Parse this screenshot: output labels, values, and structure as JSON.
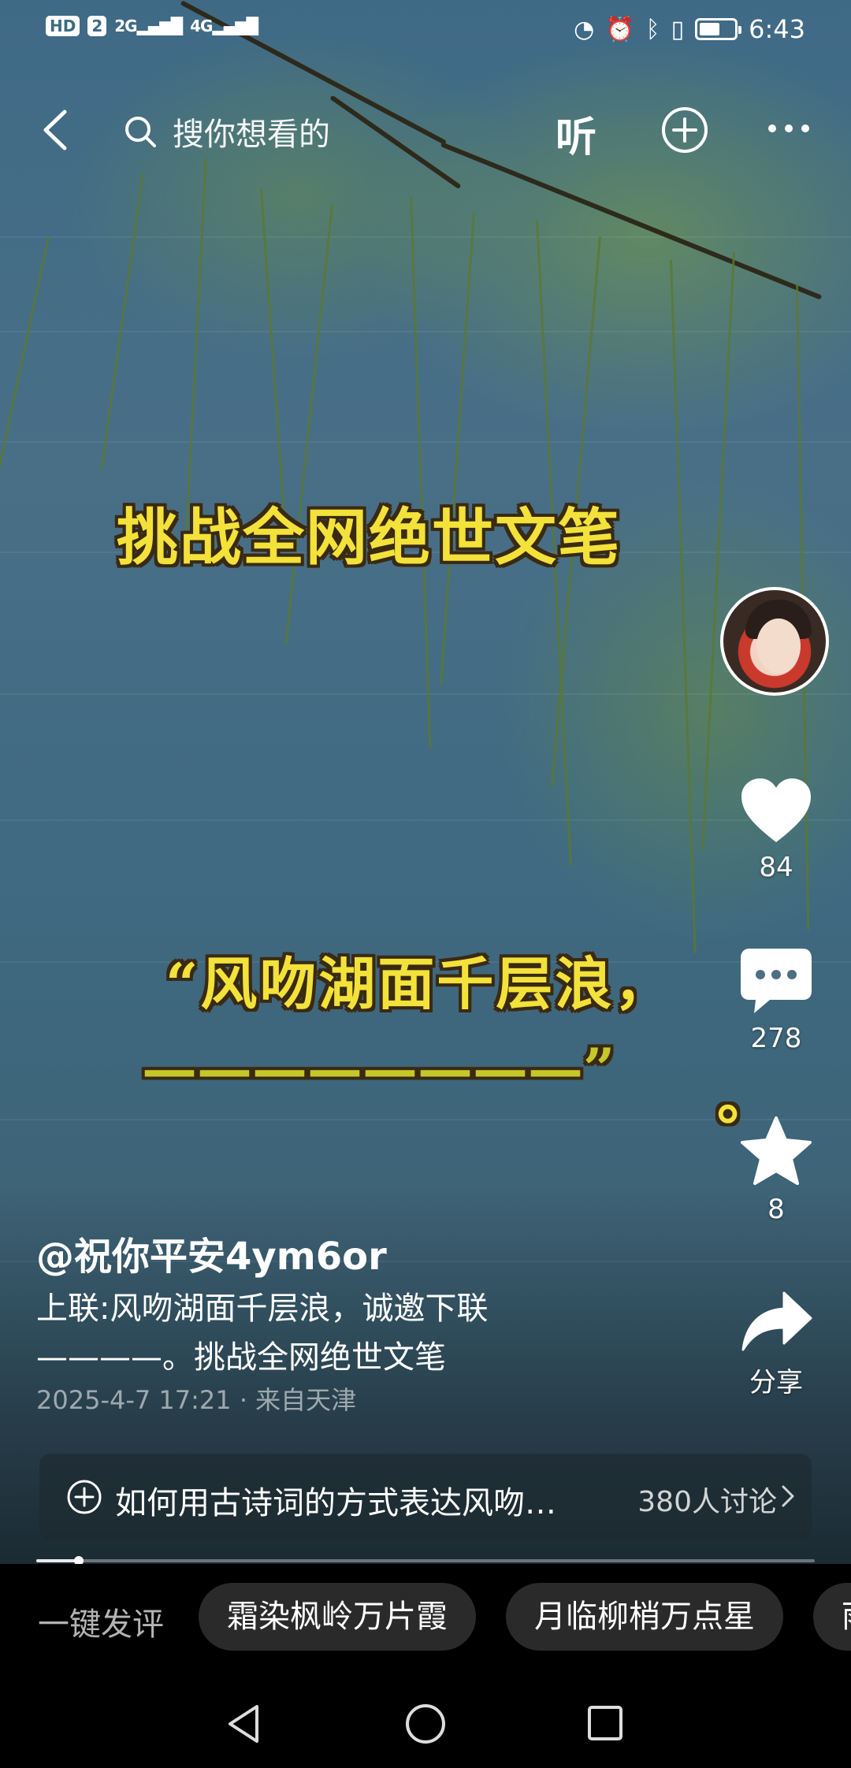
{
  "status_bar": {
    "hd_badge": "HD",
    "sim": "2",
    "network1": "2G",
    "network2": "4G",
    "time": "6:43",
    "battery_level": 0.6
  },
  "top_bar": {
    "search_placeholder": "搜你想看的",
    "listen_label": "听"
  },
  "video": {
    "caption_title": "挑战全网绝世文笔",
    "caption_line1": "“风吻湖面千层浪，",
    "caption_line2": "————————”",
    "caption_end": "。"
  },
  "actions": {
    "like_count": "84",
    "comment_count": "278",
    "favorite_count": "8",
    "share_label": "分享"
  },
  "post": {
    "author": "@祝你平安4ym6or",
    "description_line1": "上联:风吻湖面千层浪，诚邀下联",
    "description_line2": "————。挑战全网绝世文笔",
    "meta": "2025-4-7 17:21 · 来自天津"
  },
  "topic": {
    "text": "如何用古诗词的方式表达风吻…",
    "count": "380人讨论"
  },
  "progress": {
    "fraction": 0.055
  },
  "quick_reply": {
    "label": "一键发评",
    "chips": [
      "霜染枫岭万片霞",
      "月临柳梢万点星",
      "雨"
    ]
  }
}
